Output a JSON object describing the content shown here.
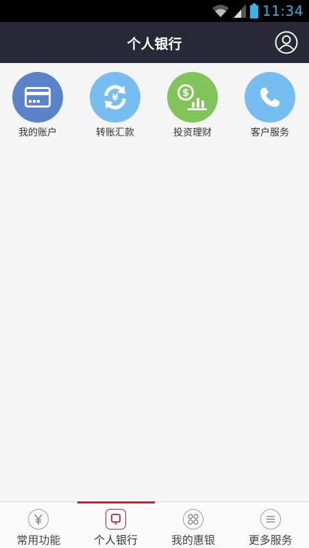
{
  "status_bar": {
    "time": "11:34",
    "icons": [
      "wifi-icon",
      "signal-icon",
      "battery-icon"
    ],
    "accent_color": "#33b5e5"
  },
  "header": {
    "title": "个人银行",
    "profile_icon": "user-icon",
    "background": "#272a36"
  },
  "grid": {
    "items": [
      {
        "label": "我的账户",
        "icon": "card-icon",
        "color": "#5b83c9"
      },
      {
        "label": "转账汇款",
        "icon": "transfer-icon",
        "color": "#78bdf0"
      },
      {
        "label": "投资理财",
        "icon": "invest-icon",
        "color": "#80c45a"
      },
      {
        "label": "客户服务",
        "icon": "phone-icon",
        "color": "#74bef2"
      }
    ]
  },
  "bottom_nav": {
    "items": [
      {
        "label": "常用功能",
        "icon": "yen-icon",
        "active": false
      },
      {
        "label": "个人银行",
        "icon": "phone-device-icon",
        "active": true
      },
      {
        "label": "我的惠银",
        "icon": "grid-icon",
        "active": false
      },
      {
        "label": "更多服务",
        "icon": "menu-icon",
        "active": false
      }
    ],
    "active_color": "#b0233a"
  }
}
